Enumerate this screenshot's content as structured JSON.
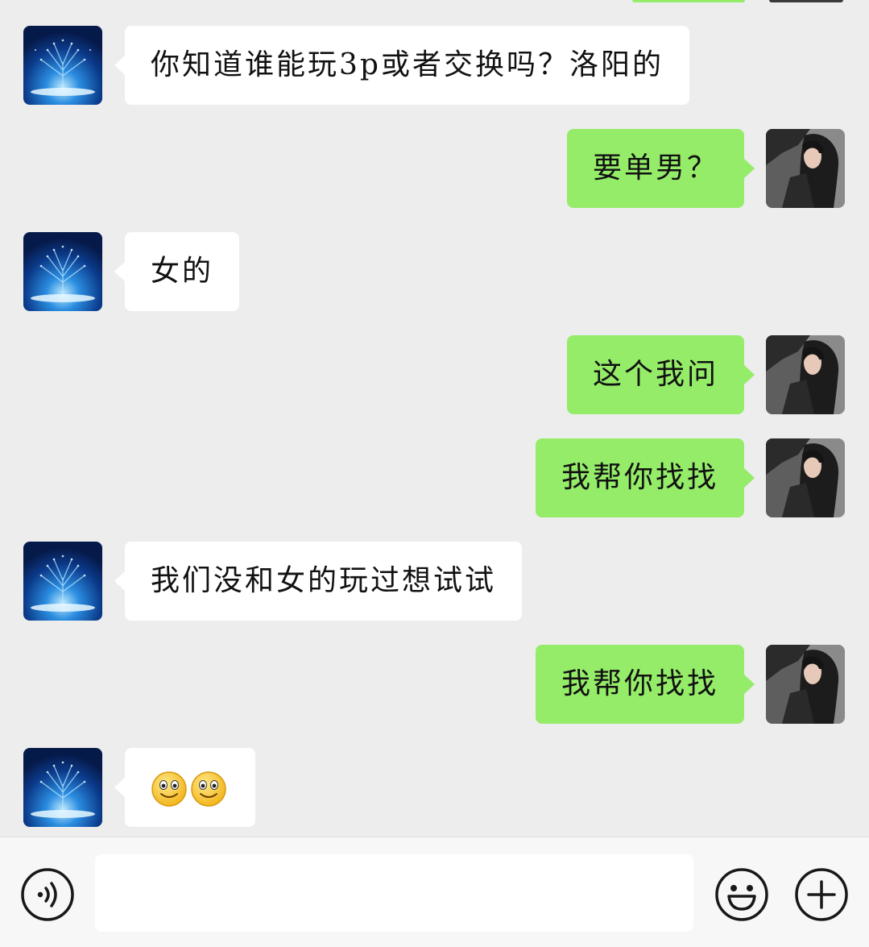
{
  "messages": [
    {
      "side": "left",
      "text": "你知道谁能玩3p或者交换吗？洛阳的"
    },
    {
      "side": "right",
      "text": "要单男？"
    },
    {
      "side": "left",
      "text": "女的"
    },
    {
      "side": "right",
      "text": "这个我问"
    },
    {
      "side": "right",
      "text": "我帮你找找"
    },
    {
      "side": "left",
      "text": "我们没和女的玩过想试试"
    },
    {
      "side": "right",
      "text": "我帮你找找"
    },
    {
      "side": "left",
      "emoji": [
        "smile-emoji",
        "smile-emoji"
      ]
    }
  ],
  "input": {
    "value": ""
  },
  "icons": {
    "voice": "voice-icon",
    "emoji": "emoji-icon",
    "plus": "plus-icon"
  },
  "colors": {
    "background": "#ededed",
    "bubble_sent": "#95ec69",
    "bubble_received": "#ffffff",
    "input_bar": "#f7f7f7"
  }
}
